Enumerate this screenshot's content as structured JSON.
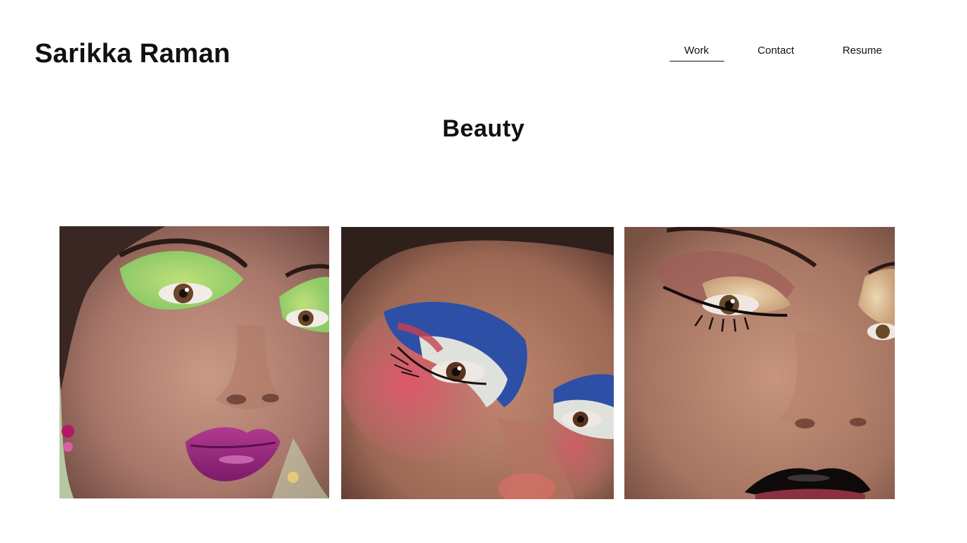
{
  "site": {
    "title": "Sarikka Raman"
  },
  "nav": {
    "items": [
      {
        "label": "Work",
        "active": true
      },
      {
        "label": "Contact",
        "active": false
      },
      {
        "label": "Resume",
        "active": false
      }
    ]
  },
  "section": {
    "title": "Beauty"
  },
  "gallery": {
    "images": [
      {
        "alt": "Close-up portrait with green eyeshadow and magenta lips"
      },
      {
        "alt": "Close-up portrait with blue, white and pink graphic eye makeup"
      },
      {
        "alt": "Close-up portrait with gold eyeshadow and black glossy lips"
      }
    ]
  },
  "colors": {
    "text": "#111111",
    "background": "#ffffff"
  }
}
